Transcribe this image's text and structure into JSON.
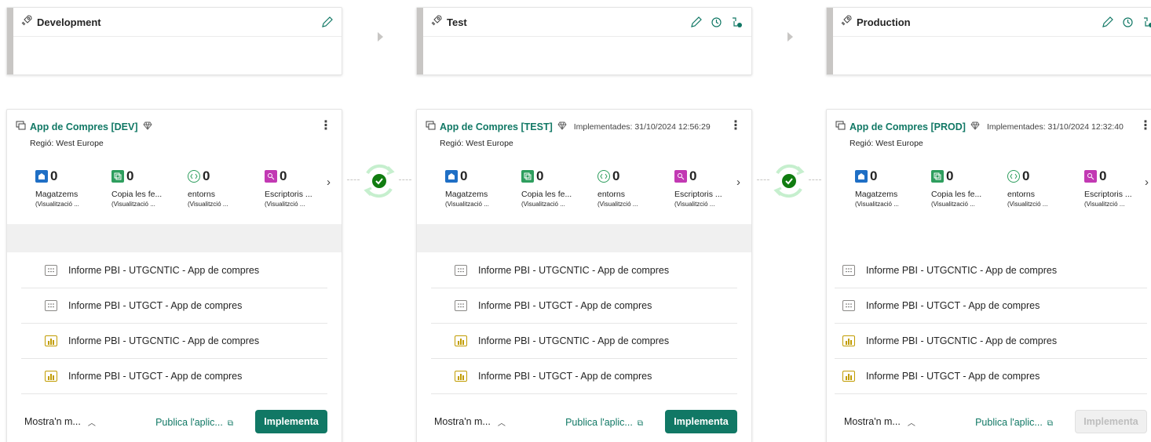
{
  "stages": [
    {
      "title": "Development",
      "actions": [
        "pencil-icon"
      ]
    },
    {
      "title": "Test",
      "actions": [
        "pencil-icon",
        "history-icon",
        "rule-icon"
      ]
    },
    {
      "title": "Production",
      "actions": [
        "pencil-icon",
        "history-icon",
        "rule-icon"
      ]
    }
  ],
  "workspaces": [
    {
      "name": "App de Compres [DEV]",
      "implemented": "",
      "region": "Regió: West Europe",
      "metrics": [
        {
          "count": "0",
          "label": "Magatzems",
          "sub": "(Visualització ..."
        },
        {
          "count": "0",
          "label": "Copia les fe...",
          "sub": "(Visualització ..."
        },
        {
          "count": "0",
          "label": "entorns",
          "sub": "(Visualitzció ..."
        },
        {
          "count": "0",
          "label": "Escriptoris ...",
          "sub": "(Visualitzció ..."
        }
      ],
      "items": [
        {
          "icon": "dashboard-icon",
          "text": "Informe PBI - UTGCNTIC - App de compres"
        },
        {
          "icon": "dashboard-icon",
          "text": "Informe PBI - UTGCT - App de compres"
        },
        {
          "icon": "report-icon",
          "text": "Informe PBI - UTGCNTIC - App de compres"
        },
        {
          "icon": "report-icon",
          "text": "Informe PBI - UTGCT - App de compres"
        }
      ],
      "show_more": "Mostra'n m...",
      "publish": "Publica l'aplic...",
      "implement": "Implementa",
      "implement_enabled": true
    },
    {
      "name": "App de Compres [TEST]",
      "implemented": "Implementades: 31/10/2024 12:56:29",
      "region": "Regió: West Europe",
      "metrics": [
        {
          "count": "0",
          "label": "Magatzems",
          "sub": "(Visualització ..."
        },
        {
          "count": "0",
          "label": "Copia les fe...",
          "sub": "(Visualització ..."
        },
        {
          "count": "0",
          "label": "entorns",
          "sub": "(Visualitzció ..."
        },
        {
          "count": "0",
          "label": "Escriptoris ...",
          "sub": "(Visualitzció ..."
        }
      ],
      "items": [
        {
          "icon": "dashboard-icon",
          "text": "Informe PBI - UTGCNTIC - App de compres"
        },
        {
          "icon": "dashboard-icon",
          "text": "Informe PBI - UTGCT - App de compres"
        },
        {
          "icon": "report-icon",
          "text": "Informe PBI - UTGCNTIC - App de compres"
        },
        {
          "icon": "report-icon",
          "text": "Informe PBI - UTGCT - App de compres"
        }
      ],
      "show_more": "Mostra'n m...",
      "publish": "Publica l'aplic...",
      "implement": "Implementa",
      "implement_enabled": true
    },
    {
      "name": "App de Compres [PROD]",
      "implemented": "Implementades: 31/10/2024 12:32:40",
      "region": "Regió: West Europe",
      "metrics": [
        {
          "count": "0",
          "label": "Magatzems",
          "sub": "(Visualització ..."
        },
        {
          "count": "0",
          "label": "Copia les fe...",
          "sub": "(Visualització ..."
        },
        {
          "count": "0",
          "label": "entorns",
          "sub": "(Visualitzció ..."
        },
        {
          "count": "0",
          "label": "Escriptoris ...",
          "sub": "(Visualitzció ..."
        }
      ],
      "items": [
        {
          "icon": "dashboard-icon",
          "text": "Informe PBI - UTGCNTIC - App de compres"
        },
        {
          "icon": "dashboard-icon",
          "text": "Informe PBI - UTGCT - App de compres"
        },
        {
          "icon": "report-icon",
          "text": "Informe PBI - UTGCNTIC - App de compres"
        },
        {
          "icon": "report-icon",
          "text": "Informe PBI - UTGCT - App de compres"
        }
      ],
      "show_more": "Mostra'n m...",
      "publish": "Publica l'aplic...",
      "implement": "Implementa",
      "implement_enabled": false
    }
  ],
  "colors": {
    "accent": "#117865",
    "sync": "#107c10",
    "stage_bar": "#c8c6c4"
  }
}
